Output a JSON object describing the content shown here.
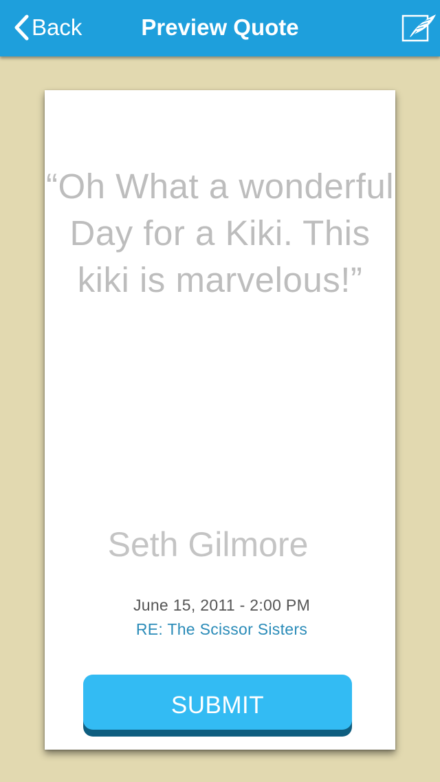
{
  "navbar": {
    "back_label": "Back",
    "title": "Preview Quote",
    "back_icon": "chevron-left-icon",
    "compose_icon": "quill-pen-icon"
  },
  "quote": {
    "text": "“Oh What a wonderful Day for a Kiki.  This kiki is marvelous!”",
    "author": "Seth Gilmore",
    "date": "June 15, 2011 - 2:00 PM",
    "re": "RE: The Scissor Sisters"
  },
  "actions": {
    "submit_label": "SUBMIT"
  },
  "colors": {
    "navbar": "#1e9fdc",
    "background": "#e2d9b0",
    "button": "#33bbf3",
    "button_shadow": "#0f5e80",
    "link": "#2a8bb8"
  }
}
